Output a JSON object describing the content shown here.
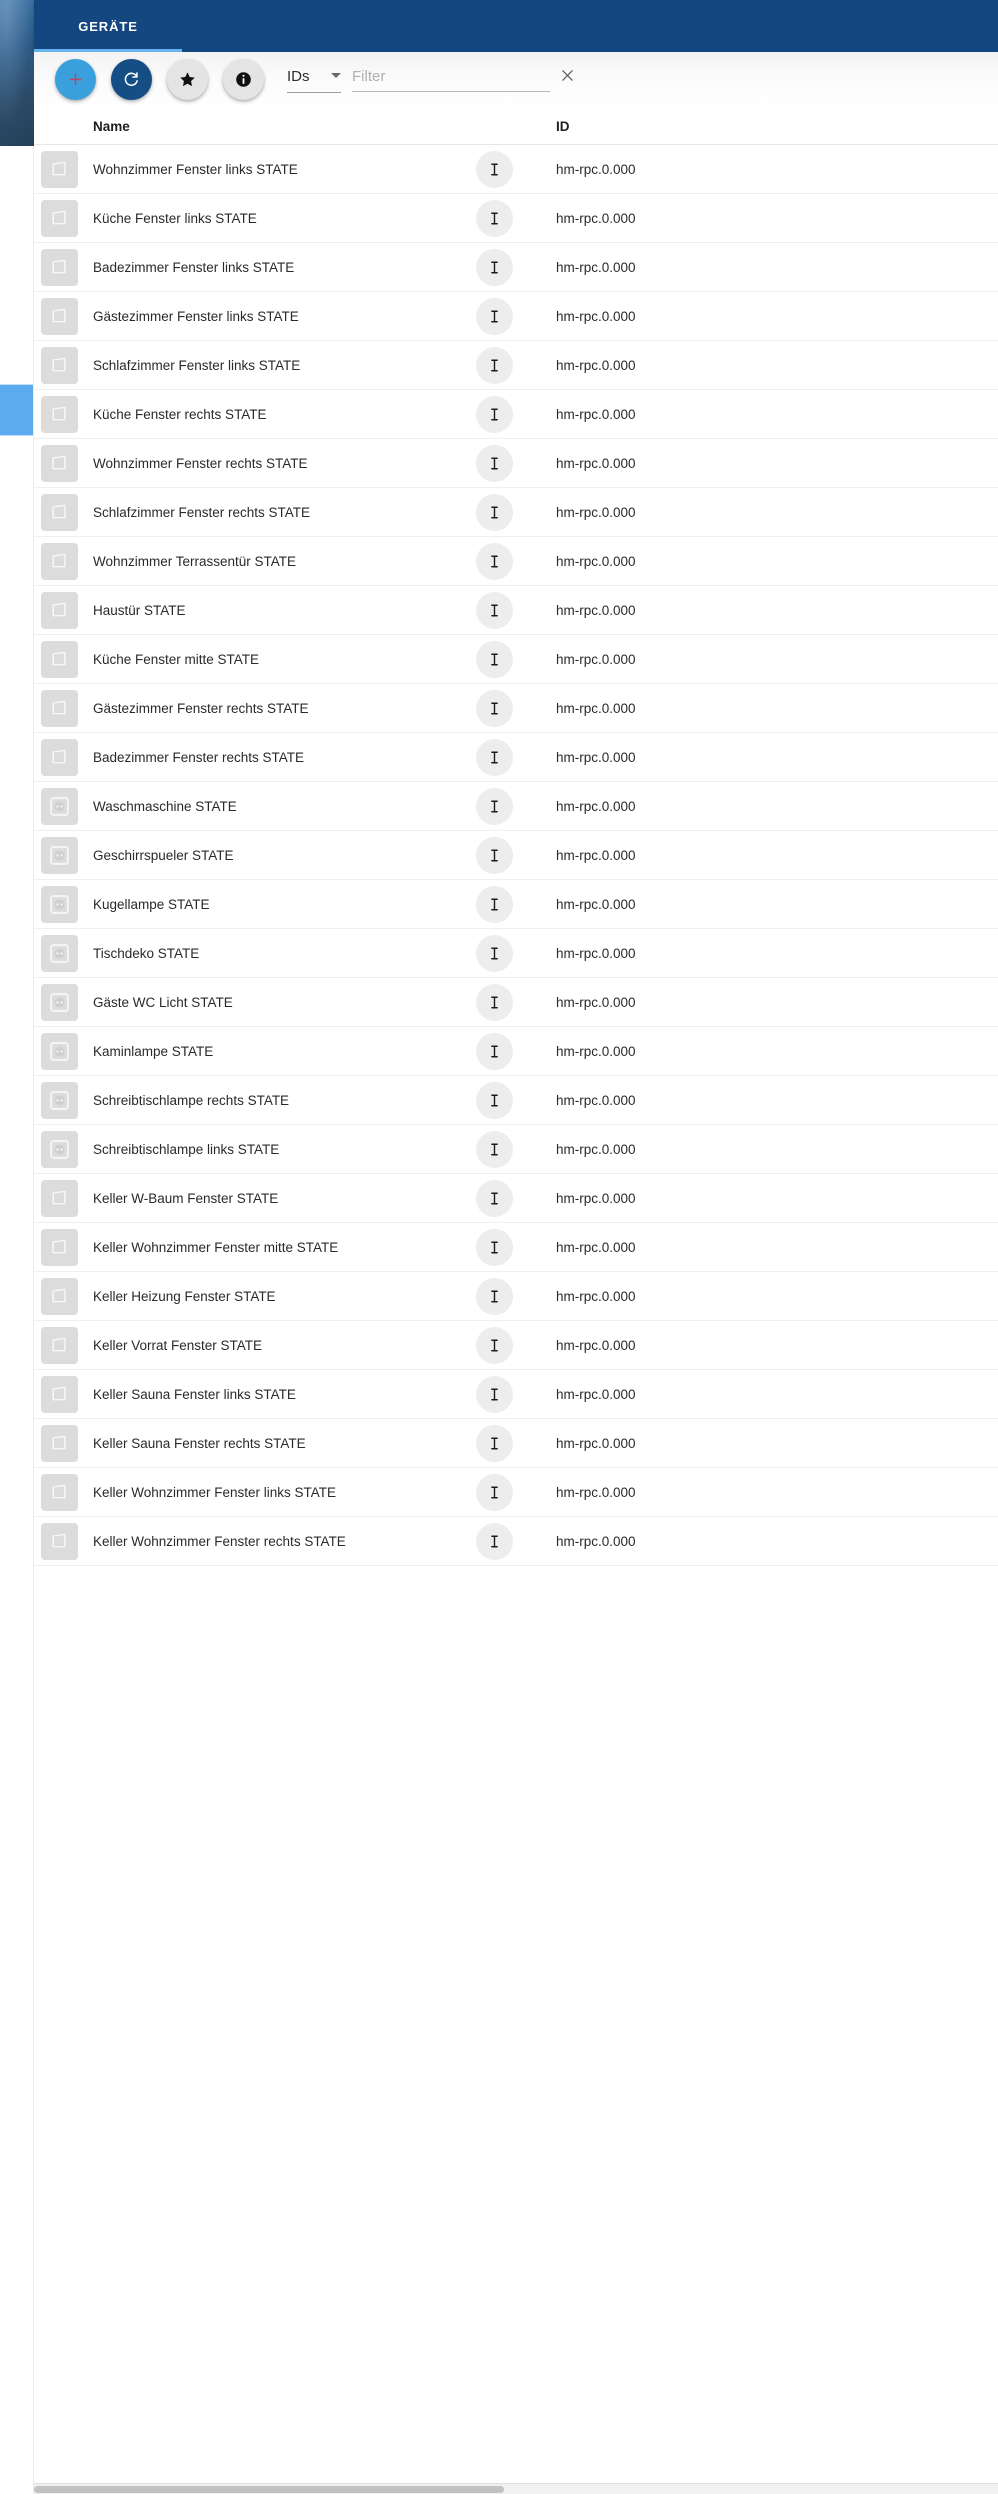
{
  "window": {
    "selected_rail_item": "objects-rail-item"
  },
  "tabs": [
    {
      "label": "GERÄTE",
      "active": true
    }
  ],
  "toolbar": {
    "add_label": "+",
    "add_icon": "plus-icon",
    "refresh_icon": "refresh-icon",
    "favorite_icon": "star-icon",
    "info_icon": "info-icon",
    "clear_icon": "close-icon",
    "select": {
      "value": "IDs",
      "caret_icon": "chevron-down-icon"
    },
    "filter": {
      "value": "",
      "placeholder": "Filter"
    }
  },
  "table": {
    "columns": [
      {
        "key": "name",
        "label": "Name"
      },
      {
        "key": "id",
        "label": "ID"
      }
    ],
    "row_type_icon": "text-cursor-icon",
    "rows": [
      {
        "icon": "window-sensor-icon",
        "name": "Wohnzimmer Fenster links STATE",
        "id": "hm-rpc.0.000"
      },
      {
        "icon": "window-sensor-icon",
        "name": "Küche Fenster links STATE",
        "id": "hm-rpc.0.000"
      },
      {
        "icon": "window-sensor-icon",
        "name": "Badezimmer Fenster links STATE",
        "id": "hm-rpc.0.000"
      },
      {
        "icon": "window-sensor-icon",
        "name": "Gästezimmer Fenster links STATE",
        "id": "hm-rpc.0.000"
      },
      {
        "icon": "window-sensor-icon",
        "name": "Schlafzimmer Fenster links STATE",
        "id": "hm-rpc.0.000"
      },
      {
        "icon": "window-sensor-icon",
        "name": "Küche Fenster rechts STATE",
        "id": "hm-rpc.0.000"
      },
      {
        "icon": "window-sensor-icon",
        "name": "Wohnzimmer Fenster rechts STATE",
        "id": "hm-rpc.0.000"
      },
      {
        "icon": "window-sensor-icon",
        "name": "Schlafzimmer Fenster rechts STATE",
        "id": "hm-rpc.0.000"
      },
      {
        "icon": "window-sensor-icon",
        "name": "Wohnzimmer Terrassentür STATE",
        "id": "hm-rpc.0.000"
      },
      {
        "icon": "window-sensor-icon",
        "name": "Haustür STATE",
        "id": "hm-rpc.0.000"
      },
      {
        "icon": "window-sensor-icon",
        "name": "Küche Fenster mitte STATE",
        "id": "hm-rpc.0.000"
      },
      {
        "icon": "window-sensor-icon",
        "name": "Gästezimmer Fenster rechts STATE",
        "id": "hm-rpc.0.000"
      },
      {
        "icon": "window-sensor-icon",
        "name": "Badezimmer Fenster rechts STATE",
        "id": "hm-rpc.0.000"
      },
      {
        "icon": "power-socket-icon",
        "name": "Waschmaschine STATE",
        "id": "hm-rpc.0.000"
      },
      {
        "icon": "power-socket-icon",
        "name": "Geschirrspueler STATE",
        "id": "hm-rpc.0.000"
      },
      {
        "icon": "power-socket-icon",
        "name": "Kugellampe STATE",
        "id": "hm-rpc.0.000"
      },
      {
        "icon": "power-socket-icon",
        "name": "Tischdeko STATE",
        "id": "hm-rpc.0.000"
      },
      {
        "icon": "power-socket-icon",
        "name": "Gäste WC Licht STATE",
        "id": "hm-rpc.0.000"
      },
      {
        "icon": "power-socket-icon",
        "name": "Kaminlampe STATE",
        "id": "hm-rpc.0.000"
      },
      {
        "icon": "power-socket-icon",
        "name": "Schreibtischlampe rechts STATE",
        "id": "hm-rpc.0.000"
      },
      {
        "icon": "power-socket-icon",
        "name": "Schreibtischlampe links STATE",
        "id": "hm-rpc.0.000"
      },
      {
        "icon": "window-sensor-icon",
        "name": "Keller W-Baum Fenster STATE",
        "id": "hm-rpc.0.000"
      },
      {
        "icon": "window-sensor-icon",
        "name": "Keller Wohnzimmer Fenster mitte STATE",
        "id": "hm-rpc.0.000"
      },
      {
        "icon": "window-sensor-icon",
        "name": "Keller Heizung Fenster STATE",
        "id": "hm-rpc.0.000"
      },
      {
        "icon": "window-sensor-icon",
        "name": "Keller Vorrat Fenster STATE",
        "id": "hm-rpc.0.000"
      },
      {
        "icon": "window-sensor-icon",
        "name": "Keller Sauna Fenster links STATE",
        "id": "hm-rpc.0.000"
      },
      {
        "icon": "window-sensor-icon",
        "name": "Keller Sauna Fenster rechts STATE",
        "id": "hm-rpc.0.000"
      },
      {
        "icon": "window-sensor-icon",
        "name": "Keller Wohnzimmer Fenster links STATE",
        "id": "hm-rpc.0.000"
      },
      {
        "icon": "window-sensor-icon",
        "name": "Keller Wohnzimmer Fenster rechts STATE",
        "id": "hm-rpc.0.000"
      }
    ]
  },
  "colors": {
    "tabbar": "#14467f",
    "tab_indicator": "#66b3f0",
    "fab_add": "#3aa0dd",
    "fab_refresh": "#154d85",
    "rail_selected": "#5aabf0"
  }
}
